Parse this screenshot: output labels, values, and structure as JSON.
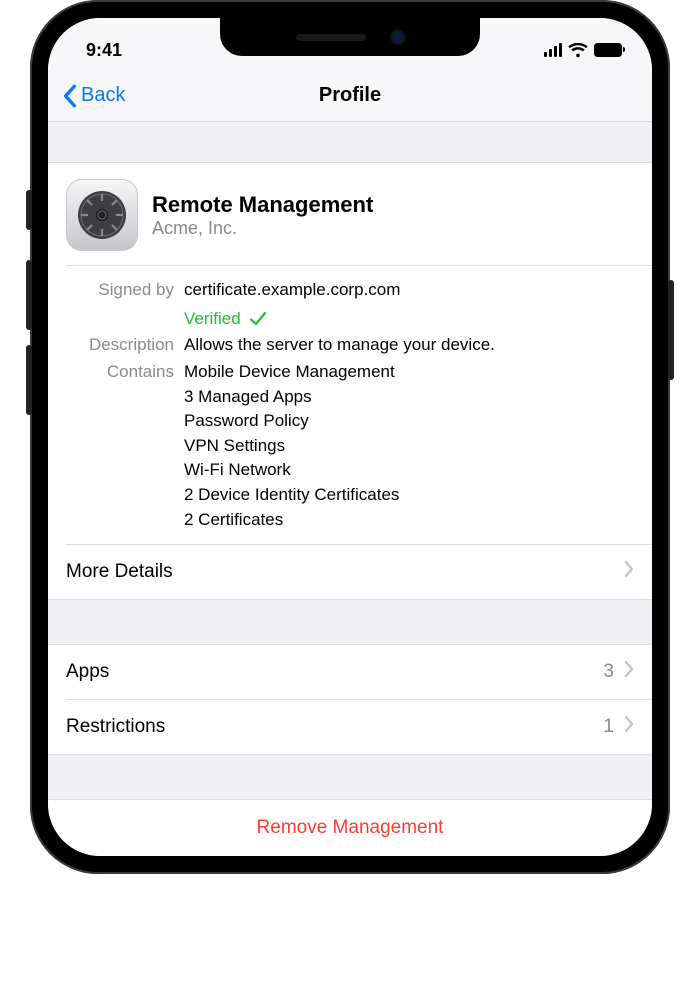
{
  "status": {
    "time": "9:41"
  },
  "nav": {
    "back": "Back",
    "title": "Profile"
  },
  "profile": {
    "title": "Remote Management",
    "org": "Acme, Inc."
  },
  "signed": {
    "label": "Signed by",
    "value": "certificate.example.corp.com",
    "status": "Verified"
  },
  "description": {
    "label": "Description",
    "value": "Allows the server to manage your device."
  },
  "contains": {
    "label": "Contains",
    "items": [
      "Mobile Device Management",
      "3 Managed Apps",
      "Password Policy",
      "VPN Settings",
      "Wi-Fi Network",
      "2 Device Identity Certificates",
      "2 Certificates"
    ]
  },
  "links": {
    "more_details": "More Details",
    "apps": {
      "label": "Apps",
      "count": "3"
    },
    "restrictions": {
      "label": "Restrictions",
      "count": "1"
    }
  },
  "action": {
    "remove": "Remove Management"
  }
}
